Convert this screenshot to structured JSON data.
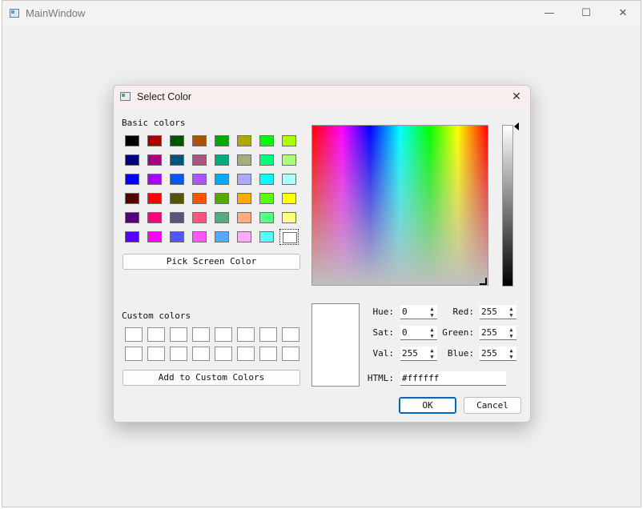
{
  "main_window": {
    "title": "MainWindow",
    "minimize": "—",
    "maximize": "☐",
    "close": "✕"
  },
  "dialog": {
    "title": "Select Color",
    "close": "✕",
    "basic_colors_label": "Basic colors",
    "basic_colors": [
      [
        "#000000",
        "#aa0000",
        "#005500",
        "#aa5500",
        "#00aa00",
        "#aaaa00",
        "#00ff00",
        "#aaff00"
      ],
      [
        "#00007f",
        "#aa007f",
        "#00557f",
        "#aa557f",
        "#00aa7f",
        "#aaaa7f",
        "#00ff7f",
        "#aaff7f"
      ],
      [
        "#0000ff",
        "#aa00ff",
        "#0055ff",
        "#aa55ff",
        "#00aaff",
        "#aaaaff",
        "#00ffff",
        "#aaffff"
      ],
      [
        "#550000",
        "#ff0000",
        "#555500",
        "#ff5500",
        "#55aa00",
        "#ffaa00",
        "#55ff00",
        "#ffff00"
      ],
      [
        "#55007f",
        "#ff007f",
        "#55557f",
        "#ff557f",
        "#55aa7f",
        "#ffaa7f",
        "#55ff7f",
        "#ffff7f"
      ],
      [
        "#5500ff",
        "#ff00ff",
        "#5555ff",
        "#ff55ff",
        "#55aaff",
        "#ffaaff",
        "#55ffff",
        "#ffffff"
      ]
    ],
    "pick_screen_color": "Pick Screen Color",
    "custom_colors_label": "Custom colors",
    "add_to_custom": "Add to Custom Colors",
    "fields": {
      "hue_label": "Hue:",
      "hue": "0",
      "sat_label": "Sat:",
      "sat": "0",
      "val_label": "Val:",
      "val": "255",
      "red_label": "Red:",
      "red": "255",
      "green_label": "Green:",
      "green": "255",
      "blue_label": "Blue:",
      "blue": "255",
      "html_label": "HTML:",
      "html": "#ffffff"
    },
    "ok": "OK",
    "cancel": "Cancel"
  }
}
